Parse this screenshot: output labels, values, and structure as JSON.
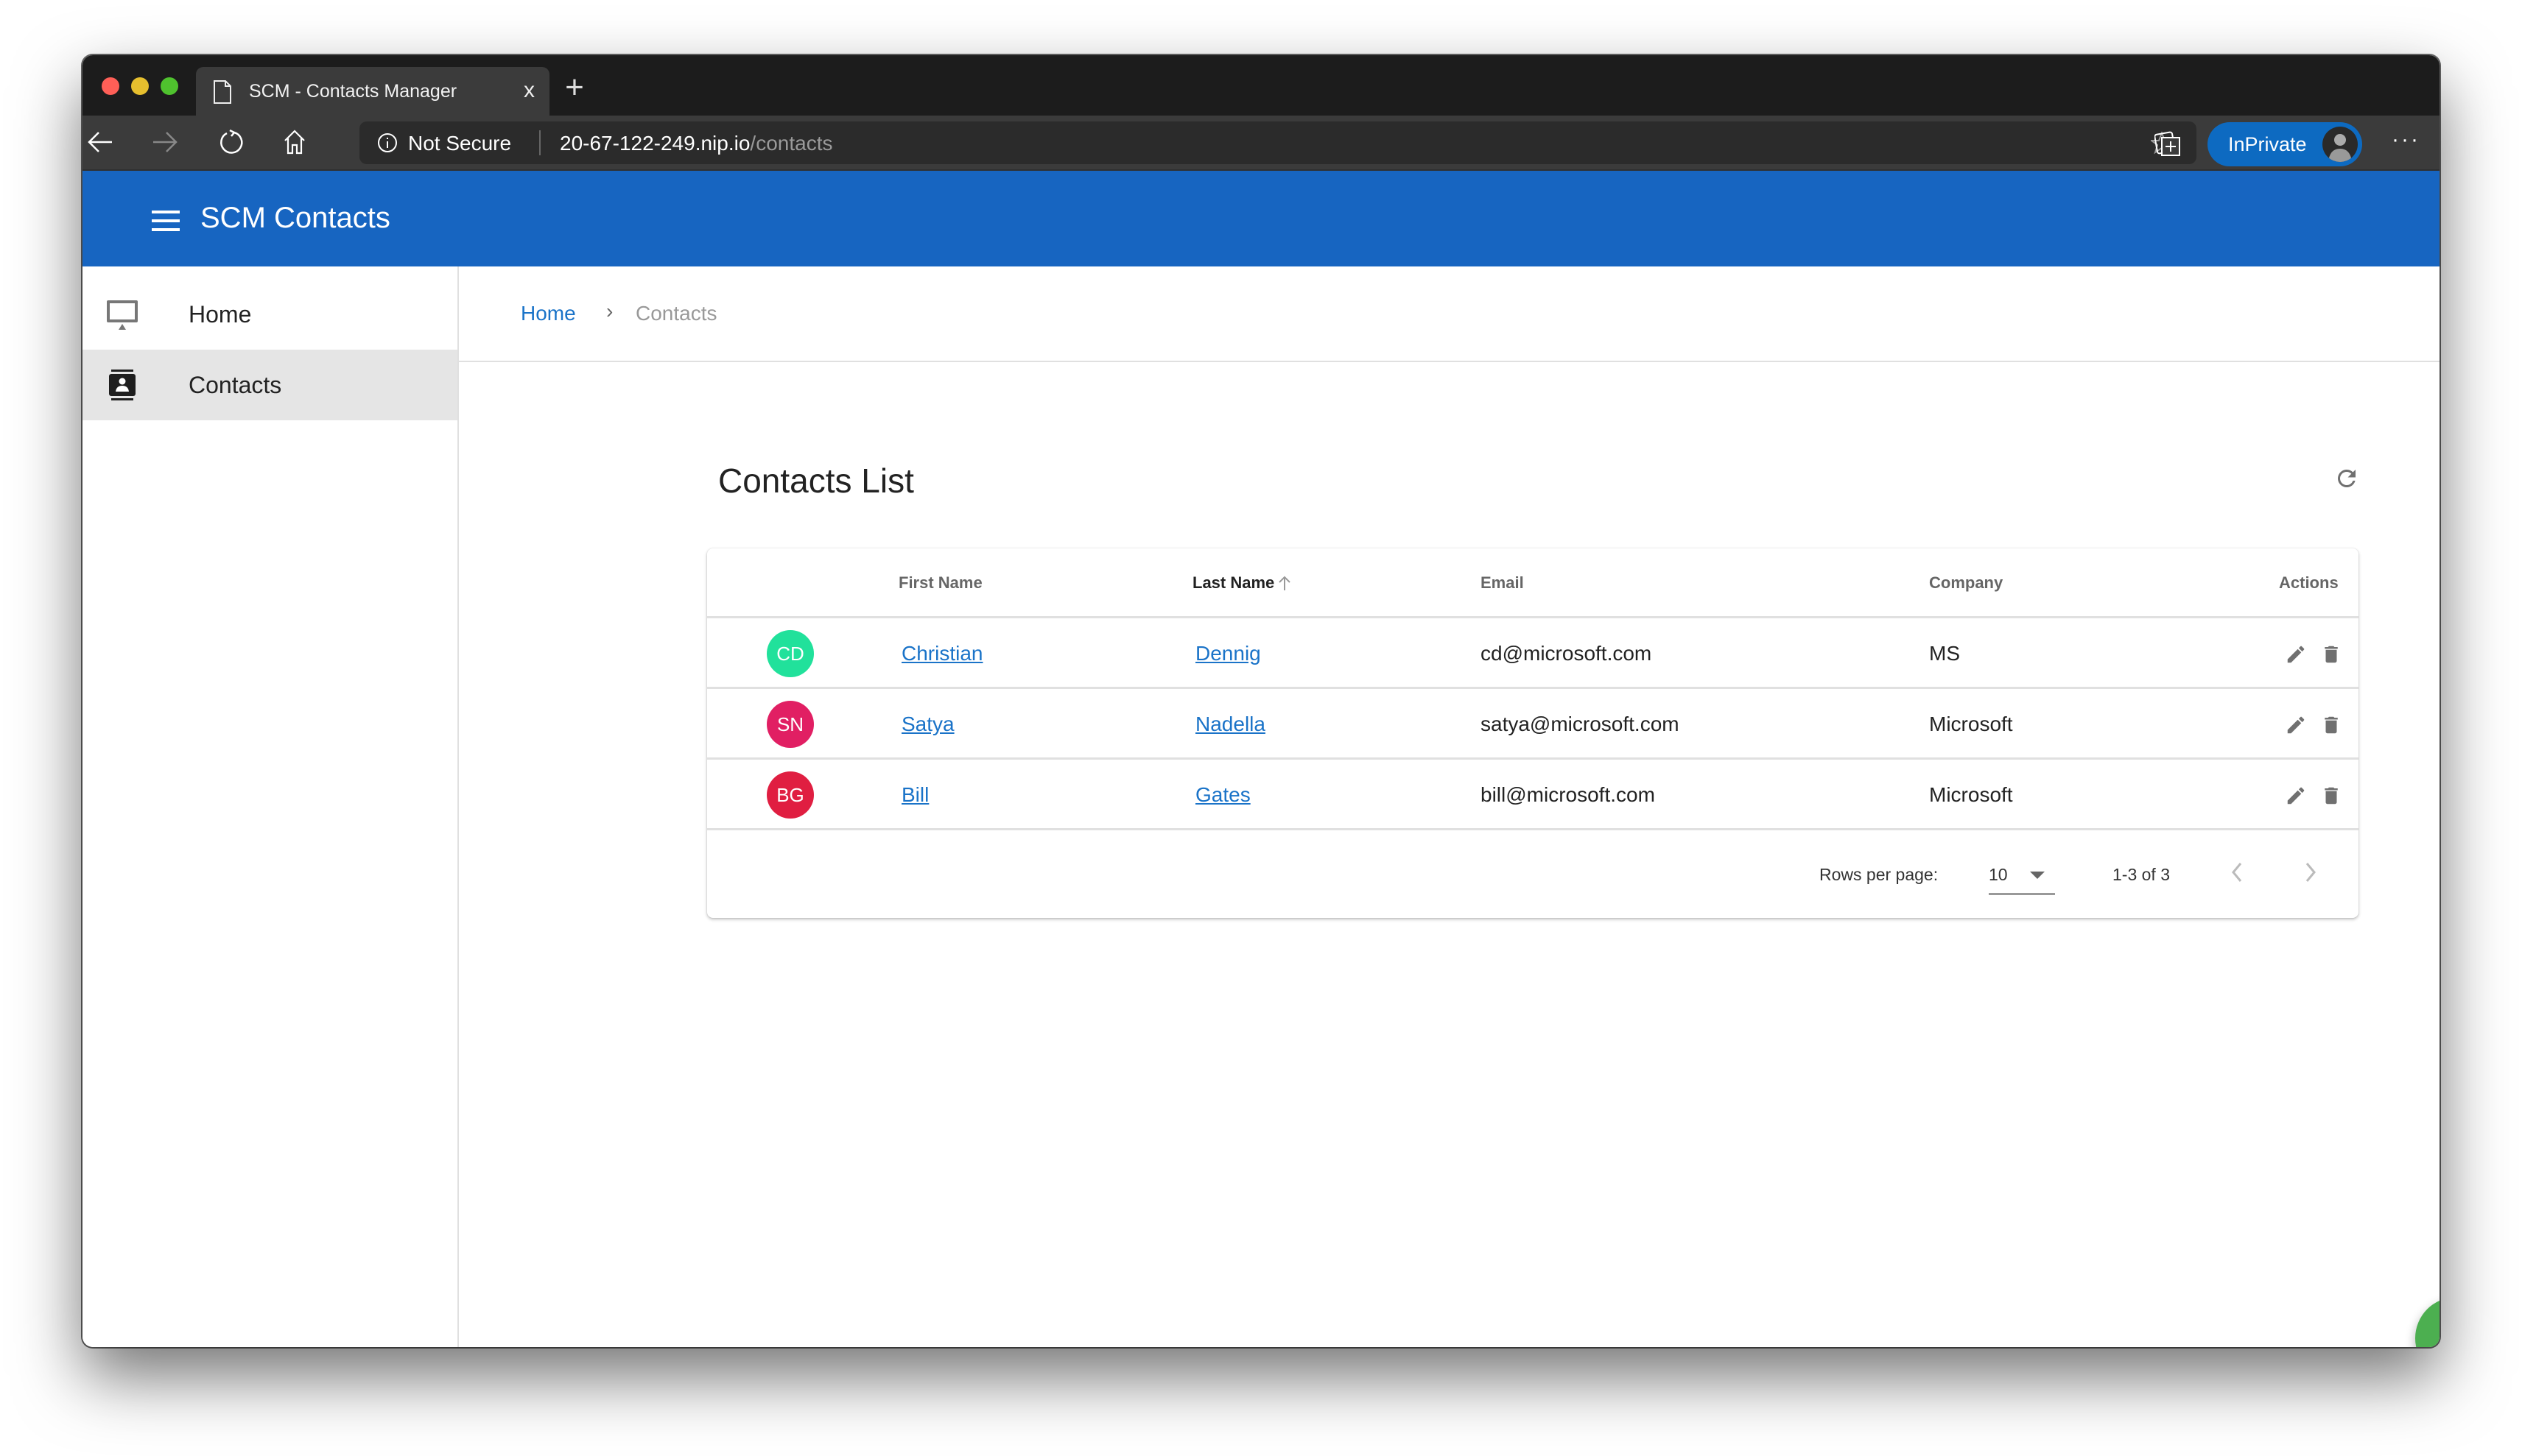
{
  "browser": {
    "tab_title": "SCM - Contacts Manager",
    "tab_close": "x",
    "new_tab": "+",
    "security_label": "Not Secure",
    "url_host": "20-67-122-249.nip.io",
    "url_path": "/contacts",
    "inprivate_label": "InPrivate",
    "more_label": "···"
  },
  "app": {
    "title": "SCM Contacts"
  },
  "sidebar": {
    "items": [
      {
        "label": "Home",
        "icon": "desktop-icon",
        "active": false
      },
      {
        "label": "Contacts",
        "icon": "contacts-icon",
        "active": true
      }
    ]
  },
  "breadcrumb": {
    "home": "Home",
    "separator": "›",
    "current": "Contacts"
  },
  "page": {
    "title": "Contacts List"
  },
  "table": {
    "columns": [
      "",
      "First Name",
      "Last Name",
      "Email",
      "Company",
      "Actions"
    ],
    "sorted_column": "Last Name",
    "sort_direction": "ascending",
    "rows": [
      {
        "initials": "CD",
        "avatar_color": "#21e19b",
        "first_name": "Christian",
        "last_name": "Dennig",
        "email": "cd@microsoft.com",
        "company": "MS"
      },
      {
        "initials": "SN",
        "avatar_color": "#e11f63",
        "first_name": "Satya",
        "last_name": "Nadella",
        "email": "satya@microsoft.com",
        "company": "Microsoft"
      },
      {
        "initials": "BG",
        "avatar_color": "#e01e41",
        "first_name": "Bill",
        "last_name": "Gates",
        "email": "bill@microsoft.com",
        "company": "Microsoft"
      }
    ]
  },
  "pagination": {
    "rows_per_page_label": "Rows per page:",
    "rows_per_page": "10",
    "range": "1-3 of 3"
  },
  "colors": {
    "app_bar": "#1765c1",
    "link": "#1a73c8",
    "fab": "#4caf50",
    "inprivate": "#0d6ac1"
  }
}
